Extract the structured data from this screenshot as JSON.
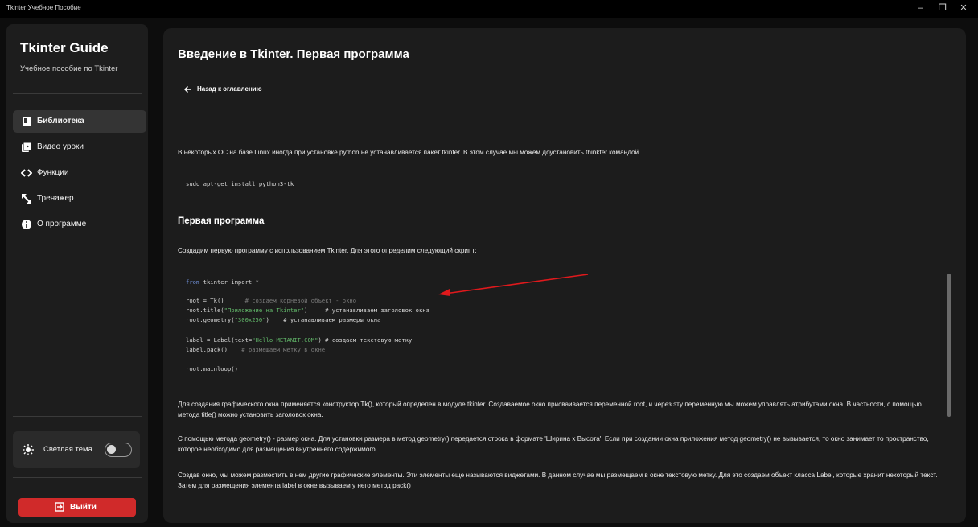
{
  "window": {
    "title": "Tkinter Учебное Пособие",
    "controls": {
      "minimize": "–",
      "restore": "❐",
      "close": "✕"
    }
  },
  "sidebar": {
    "brand": "Tkinter Guide",
    "subtitle": "Учебное пособие по Tkinter",
    "items": [
      {
        "label": "Библиотека",
        "icon": "book-icon",
        "active": true
      },
      {
        "label": "Видео уроки",
        "icon": "video-library-icon",
        "active": false
      },
      {
        "label": "Функции",
        "icon": "code-icon",
        "active": false
      },
      {
        "label": "Тренажер",
        "icon": "resize-arrows-icon",
        "active": false
      },
      {
        "label": "О программе",
        "icon": "info-icon",
        "active": false
      }
    ],
    "theme": {
      "label": "Светлая тема",
      "icon": "sun-icon",
      "enabled": false
    },
    "exit": {
      "label": "Выйти",
      "icon": "exit-icon"
    }
  },
  "content": {
    "title": "Введение в Tkinter. Первая программа",
    "back_label": "Назад к оглавлению",
    "intro": "В некоторых ОС на базе Linux иногда при установке python не устанавливается пакет tkinter. В этом случае мы можем доустановить thinkter командой",
    "install_cmd": "sudo apt-get install python3-tk",
    "section_title": "Первая программа",
    "section_intro": "Создадим первую программу с использованием Tkinter. Для этого определим следующий скрипт:",
    "code": {
      "l1_kw": "from",
      "l1_rest": " tkinter import *",
      "l2_code": "root = Tk()      ",
      "l2_cmt": "# создаем корневой объект - окно",
      "l3_a": "root.title(",
      "l3_str": "\"Приложение на Tkinter\"",
      "l3_b": ")     ",
      "l3_cmt": "# устанавливаем заголовок окна",
      "l4_a": "root.geometry(",
      "l4_str": "\"300x250\"",
      "l4_b": ")    ",
      "l4_cmt": "# устанавливаем размеры окна",
      "l5_a": "label = Label(text=",
      "l5_str": "\"Hello METANIT.COM\"",
      "l5_b": ") ",
      "l5_cmt": "# создаем текстовую метку",
      "l6_code": "label.pack()    ",
      "l6_cmt": "# размещаем метку в окне",
      "l7_code": "root.mainloop()"
    },
    "p1": "Для создания графического окна применяется конструктор Tk(), который определен в модуле tkinter. Создаваемое окно присваивается переменной root, и через эту переменную мы можем управлять атрибутами окна. В частности, с помощью метода title() можно установить заголовок окна.",
    "p2": "С помощью метода geometry() - размер окна. Для установки размера в метод geometry() передается строка в формате 'Ширина x Высота'. Если при создании окна приложения метод geometry() не вызывается, то окно занимает то пространство, которое необходимо для размещения внутреннего содержимого.",
    "p3": "Создав окно, мы можем разместить в нем другие графические элементы. Эти элементы еще называются виджетами. В данном случае мы размещаем в окне текстовую метку. Для это создаем объект класса Label, которые хранит некоторый текст. Затем для размещения элемента label в окне вызываем у него метод pack()"
  },
  "colors": {
    "accent_exit": "#d02a2a",
    "annotation_arrow": "#e0191c",
    "keyword": "#6f8fd6",
    "string": "#62b86a",
    "comment": "#7a7a7a"
  }
}
